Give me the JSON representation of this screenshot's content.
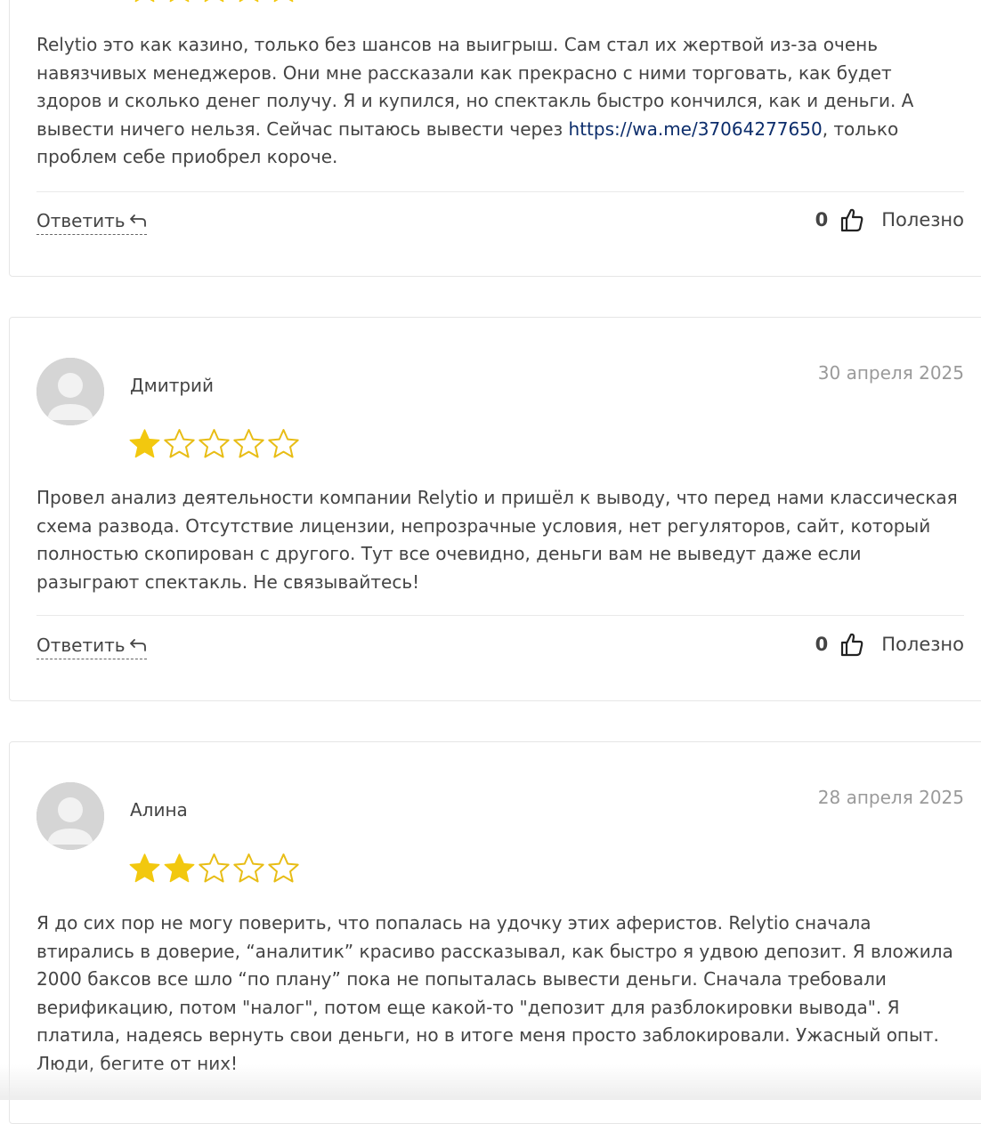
{
  "colors": {
    "star_filled": "#f2c80f",
    "star_empty_stroke": "#e8bd16",
    "link": "#0c2d6b"
  },
  "reviews": [
    {
      "author": "",
      "date": "",
      "rating": 5,
      "text_before_link": "Relytio это как казино, только без шансов на выигрыш. Сам стал их жертвой из-за очень навязчивых менеджеров. Они мне рассказали как прекрасно с ними торговать, как будет здоров и сколько денег получу. Я и купился, но спектакль быстро кончился, как и деньги. А вывести ничего нельзя. Сейчас пытаюсь вывести через ",
      "link": "https://wa.me/37064277650",
      "text_after_link": ", только проблем себе приобрел короче.",
      "reply_label": "Ответить",
      "likes": "0",
      "helpful_label": "Полезно"
    },
    {
      "author": "Дмитрий",
      "date": "30 апреля 2025",
      "rating": 1,
      "text": "Провел анализ деятельности компании Relytio и пришёл к выводу, что перед нами классическая схема развода. Отсутствие лицензии, непрозрачные условия, нет регуляторов, сайт, который полностью скопирован с другого. Тут все очевидно, деньги вам не выведут даже если разыграют спектакль. Не связывайтесь!",
      "reply_label": "Ответить",
      "likes": "0",
      "helpful_label": "Полезно"
    },
    {
      "author": "Алина",
      "date": "28 апреля 2025",
      "rating": 2,
      "text": "Я до сих пор не могу поверить, что попалась на удочку этих аферистов. Relytio сначала втирались в доверие, “аналитик” красиво рассказывал, как быстро я удвою депозит. Я вложила 2000 баксов все шло “по плану” пока не попыталась вывести деньги. Сначала требовали верификацию, потом \"налог\", потом еще какой-то \"депозит для разблокировки вывода\". Я платила, надеясь вернуть свои деньги, но в итоге меня просто заблокировали. Ужасный опыт. Люди, бегите от них!"
    }
  ]
}
